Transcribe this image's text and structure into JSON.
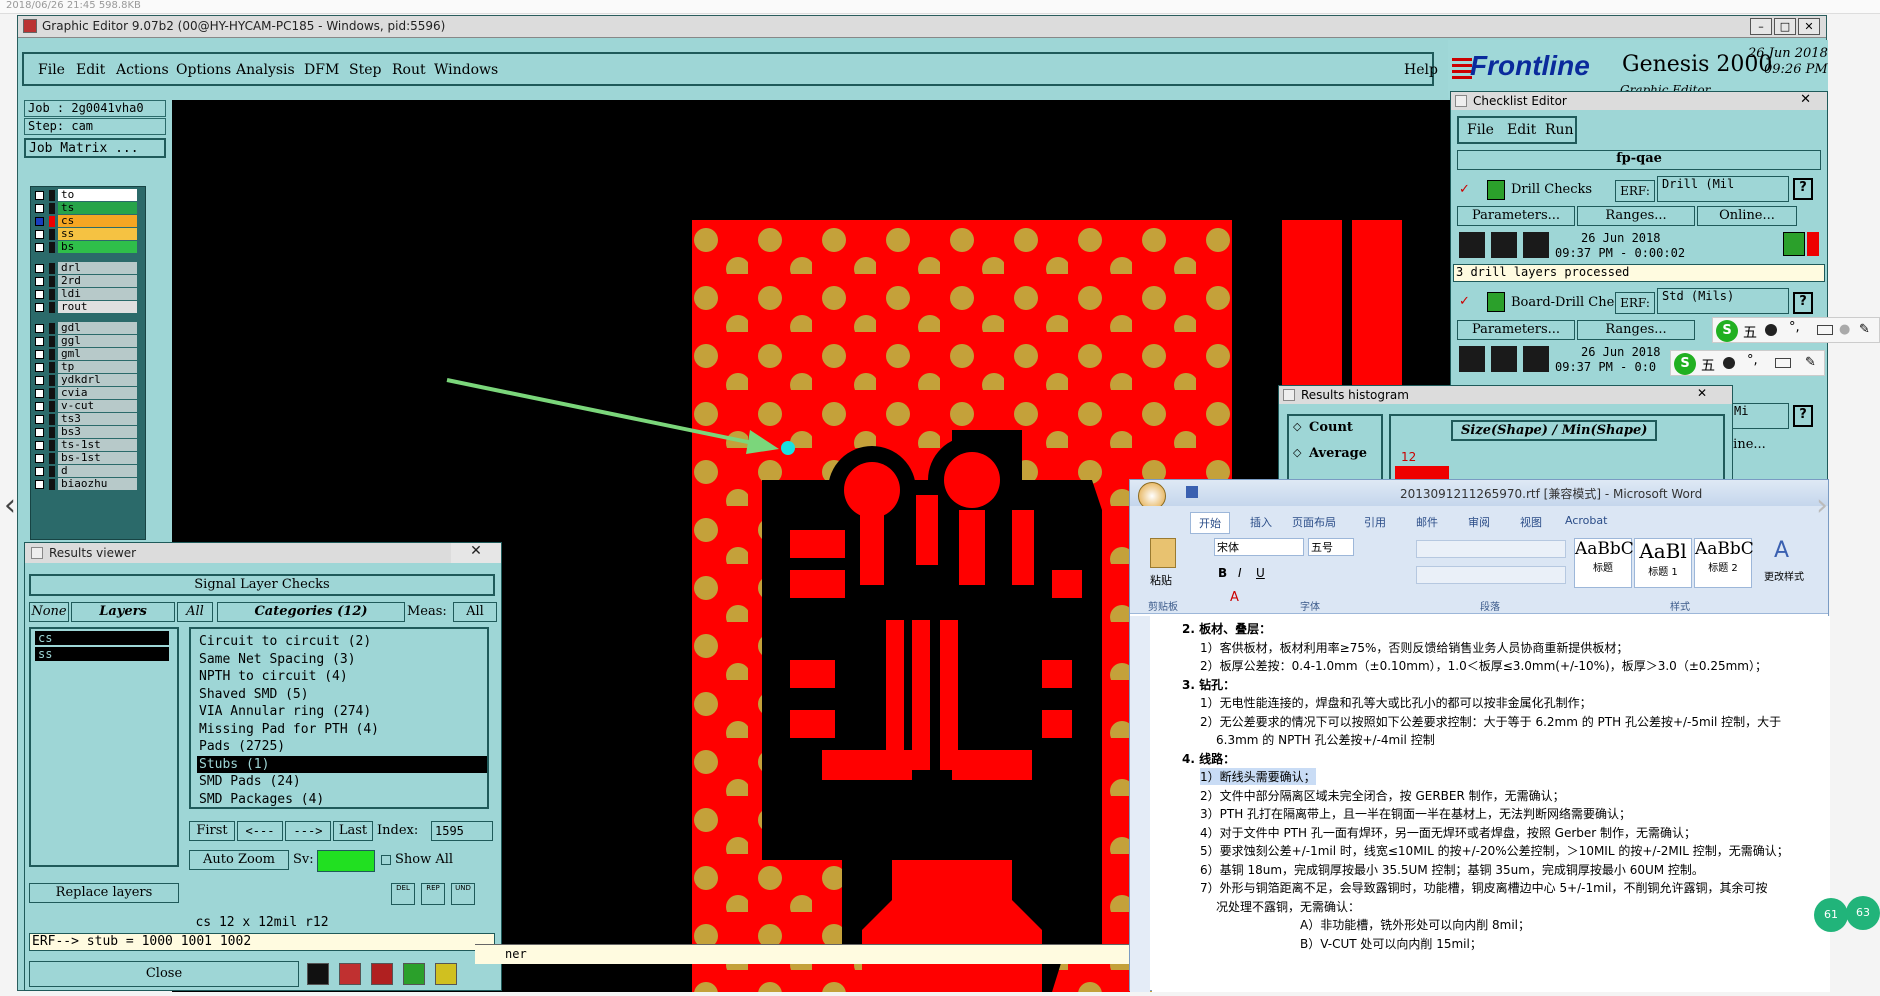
{
  "titlebar": {
    "title": "Graphic Editor 9.07b2 (00@HY-HYCAM-PC185 - Windows, pid:5596)"
  },
  "top_meta": "2018/06/26 21:45    598.8KB",
  "menu": [
    "File",
    "Edit",
    "Actions",
    "Options",
    "Analysis",
    "DFM",
    "Step",
    "Rout",
    "Windows"
  ],
  "help": "Help",
  "brand": {
    "logo": "Frontline",
    "product": "Genesis 2000",
    "subtitle": "Graphic Editor",
    "date": "26 Jun 2018",
    "time": "09:26 PM"
  },
  "job": {
    "job": "Job : 2g0041vha0",
    "step": "Step: cam",
    "matrix": "Job Matrix ..."
  },
  "layers": [
    {
      "name": "to",
      "color": "#ffffff",
      "sel": false
    },
    {
      "name": "ts",
      "color": "#26a44a",
      "sel": false
    },
    {
      "name": "cs",
      "color": "#f5a623",
      "sel": true
    },
    {
      "name": "ss",
      "color": "#f5c242",
      "sel": false
    },
    {
      "name": "bs",
      "color": "#2fbf4a",
      "sel": false
    },
    {
      "name": "drl",
      "color": "#b7c9c9",
      "sel": false
    },
    {
      "name": "2rd",
      "color": "#b7c9c9",
      "sel": false
    },
    {
      "name": "ldi",
      "color": "#b7c9c9",
      "sel": false
    },
    {
      "name": "rout",
      "color": "#e0e0e0",
      "sel": false
    },
    {
      "name": "gdl",
      "color": "#b7c9c9",
      "sel": false
    },
    {
      "name": "ggl",
      "color": "#b7c9c9",
      "sel": false
    },
    {
      "name": "gml",
      "color": "#b7c9c9",
      "sel": false
    },
    {
      "name": "tp",
      "color": "#b7c9c9",
      "sel": false
    },
    {
      "name": "ydkdrl",
      "color": "#b7c9c9",
      "sel": false
    },
    {
      "name": "cvia",
      "color": "#b7c9c9",
      "sel": false
    },
    {
      "name": "v-cut",
      "color": "#b7c9c9",
      "sel": false
    },
    {
      "name": "ts3",
      "color": "#b7c9c9",
      "sel": false
    },
    {
      "name": "bs3",
      "color": "#b7c9c9",
      "sel": false
    },
    {
      "name": "ts-1st",
      "color": "#b7c9c9",
      "sel": false
    },
    {
      "name": "bs-1st",
      "color": "#b7c9c9",
      "sel": false
    },
    {
      "name": "d",
      "color": "#b7c9c9",
      "sel": false
    },
    {
      "name": "biaozhu",
      "color": "#b7c9c9",
      "sel": false
    }
  ],
  "results_viewer": {
    "title": "Results viewer",
    "header": "Signal Layer Checks",
    "none": "None",
    "layers": "Layers",
    "all": "All",
    "categories": "Categories (12)",
    "meas_label": "Meas:",
    "meas_value": "All",
    "layer_items": [
      "cs",
      "ss"
    ],
    "cat_items": [
      "Circuit to circuit (2)",
      "Same Net Spacing (3)",
      "NPTH to circuit (4)",
      "Shaved SMD (5)",
      "VIA Annular ring (274)",
      "Missing Pad for PTH (4)",
      "Pads (2725)",
      "Stubs (1)",
      "SMD Pads (24)",
      "SMD Packages (4)"
    ],
    "selected_cat": "Stubs (1)",
    "first": "First",
    "prev": "<---",
    "next": "--->",
    "last": "Last",
    "index_label": "Index:",
    "index_value": "1595",
    "auto_zoom": "Auto Zoom",
    "sv": "Sv:",
    "show_all": "Show All",
    "replace": "Replace layers",
    "info": "cs 12 x 12mil  r12",
    "erf": "ERF--> stub = 1000 1001 1002",
    "close": "Close",
    "tag_del": "DEL",
    "tag_rep": "REP",
    "tag_und": "UND",
    "status_frag": "ner"
  },
  "checklist": {
    "title": "Checklist Editor",
    "menu": [
      "File",
      "Edit",
      "Run"
    ],
    "name": "fp-qae",
    "items": [
      {
        "title": "Drill Checks",
        "erf_label": "ERF:",
        "erf": "Drill (Mil",
        "help": "?",
        "params": "Parameters...",
        "ranges": "Ranges...",
        "online": "Online...",
        "date": "26 Jun 2018",
        "time": "09:37 PM - 0:00:02",
        "status": "3 drill layers processed"
      },
      {
        "title": "Board-Drill Che",
        "erf_label": "ERF:",
        "erf": "Std (Mils)",
        "help": "?",
        "params": "Parameters...",
        "ranges": "Ranges...",
        "online": "",
        "date": "26 Jun 2018",
        "time": "09:37 PM - 0:0",
        "status": ""
      }
    ],
    "item3": {
      "erf": "Mi",
      "help": "?",
      "online": "line..."
    }
  },
  "histogram": {
    "title": "Results histogram",
    "count": "Count",
    "average": "Average",
    "label": "Size(Shape) / Min(Shape)",
    "value": "12"
  },
  "word": {
    "title": "2013091211265970.rtf [兼容模式] - Microsoft Word",
    "tabs": [
      "开始",
      "插入",
      "页面布局",
      "引用",
      "邮件",
      "审阅",
      "视图",
      "Acrobat"
    ],
    "font": "宋体",
    "size": "五号",
    "paste": "粘贴",
    "groups": [
      "剪贴板",
      "字体",
      "段落",
      "样式"
    ],
    "styles": [
      {
        "sample": "AaBbC",
        "name": "标题"
      },
      {
        "sample": "AaBl",
        "name": "标题 1"
      },
      {
        "sample": "AaBbC",
        "name": "标题 2"
      }
    ],
    "change_style": "更改样式",
    "lines": [
      "2. 板材、叠层：",
      "1）客供板材，板材利用率≥75%，否则反馈给销售业务人员协商重新提供板材；",
      "2）板厚公差按：0.4-1.0mm（±0.10mm），1.0＜板厚≤3.0mm(+/-10%)，板厚＞3.0（±0.25mm）；",
      "3. 钻孔：",
      "1）无电性能连接的，焊盘和孔等大或比孔小的都可以按非金属化孔制作；",
      "2）无公差要求的情况下可以按照如下公差要求控制：大于等于 6.2mm 的 PTH 孔公差按+/-5mil 控制，大于",
      "6.3mm 的 NPTH 孔公差按+/-4mil 控制",
      "4. 线路：",
      "1）断线头需要确认；",
      "2）文件中部分隔离区域未完全闭合，按 GERBER 制作，无需确认；",
      "3）PTH 孔打在隔离带上，且一半在铜面一半在基材上，无法判断网络需要确认；",
      "4）对于文件中 PTH 孔一面有焊环，另一面无焊环或者焊盘，按照 Gerber 制作，无需确认；",
      "5）要求蚀刻公差+/-1mil 时，线宽≤10MIL 的按+/-20%公差控制，＞10MIL 的按+/-2MIL 控制，无需确认；",
      "6）基铜 18um，完成铜厚按最小 35.5UM 控制；基铜 35um，完成铜厚按最小 60UM 控制。",
      "7）外形与铜箔距离不足，会导致露铜时，功能槽，铜皮离槽边中心 5+/-1mil，不削铜允许露铜，其余可按",
      "况处理不露铜，无需确认：",
      "A）非功能槽，铣外形处可以向内削 8mil；",
      "B）V-CUT 处可以向内削 15mil；"
    ],
    "highlight_index": 8
  },
  "ime": {
    "char": "五"
  },
  "badges": [
    "61",
    "63"
  ]
}
